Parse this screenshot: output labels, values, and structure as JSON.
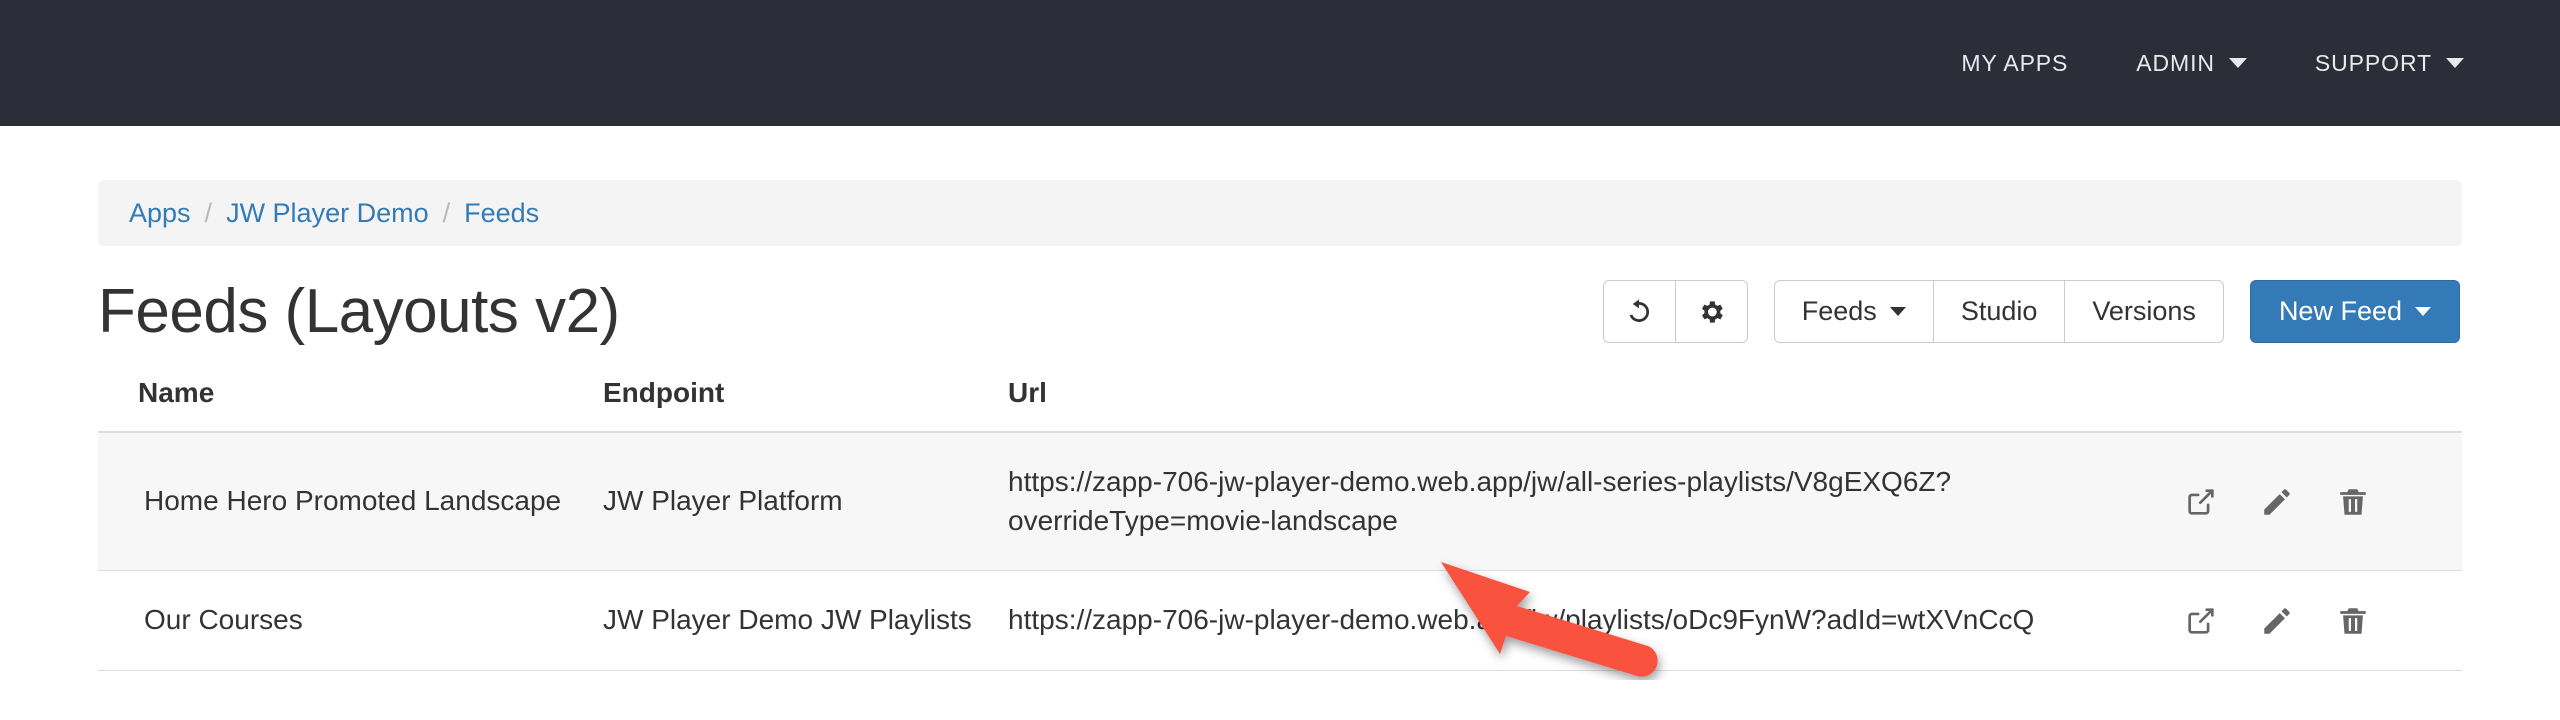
{
  "navbar": {
    "background_color": "#2b2e38",
    "items": [
      {
        "label": "MY APPS",
        "has_caret": false,
        "icon": ""
      },
      {
        "label": "ADMIN",
        "has_caret": true,
        "icon": "chevron-down-icon"
      },
      {
        "label": "SUPPORT",
        "has_caret": true,
        "icon": "chevron-down-icon"
      }
    ]
  },
  "breadcrumb": {
    "separator": "/",
    "items": [
      {
        "label": "Apps"
      },
      {
        "label": "JW Player Demo"
      },
      {
        "label": "Feeds"
      }
    ],
    "link_color": "#337ab7"
  },
  "header": {
    "title": "Feeds (Layouts v2)"
  },
  "toolbar": {
    "history_icon": "history-icon",
    "settings_icon": "gear-icon",
    "feeds_label": "Feeds",
    "studio_label": "Studio",
    "versions_label": "Versions",
    "new_feed_label": "New Feed",
    "primary_color": "#337ab7"
  },
  "table": {
    "columns": [
      "Name",
      "Endpoint",
      "Url",
      ""
    ],
    "row_actions": [
      {
        "icon": "external-link-icon",
        "name": "open-feed"
      },
      {
        "icon": "pencil-icon",
        "name": "edit-feed"
      },
      {
        "icon": "trash-icon",
        "name": "delete-feed"
      }
    ],
    "rows": [
      {
        "name": "Home Hero Promoted Landscape",
        "endpoint": "JW Player Platform",
        "url": "https://zapp-706-jw-player-demo.web.app/jw/all-series-playlists/V8gEXQ6Z?overrideType=movie-landscape",
        "highlighted": true
      },
      {
        "name": "Our Courses",
        "endpoint": "JW Player Demo JW Playlists",
        "url": "https://zapp-706-jw-player-demo.web.app/jw/playlists/oDc9FynW?adId=wtXVnCcQ",
        "highlighted": false
      }
    ]
  },
  "annotation": {
    "arrow_color": "#f9523f",
    "points_to": "overrideType=movie-landscape"
  }
}
